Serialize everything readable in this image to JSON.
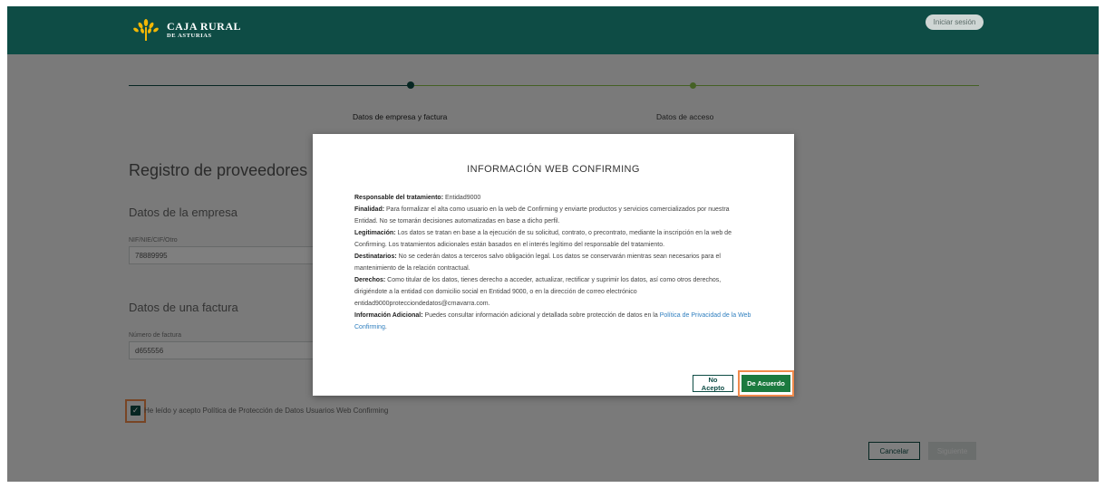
{
  "header": {
    "brand_main": "CAJA RURAL",
    "brand_sub": "DE ASTURIAS",
    "login_label": "Iniciar sesión",
    "color": "#0e4c45"
  },
  "stepper": {
    "steps": [
      {
        "label": "Datos de empresa y factura",
        "state": "active"
      },
      {
        "label": "Datos de acceso",
        "state": "pending"
      }
    ],
    "active_color": "#0e4c45",
    "pending_color": "#8bc34a"
  },
  "form": {
    "title": "Registro de proveedores",
    "company_section": "Datos de la empresa",
    "nif_label": "NIF/NIE/CIF/Otro",
    "nif_value": "78889995",
    "invoice_section": "Datos de una factura",
    "invoice_label": "Número de factura",
    "invoice_value": "d655556",
    "consent_label": "He leído y acepto Política de Protección de Datos Usuarios Web Confirming",
    "consent_checked": true,
    "cancel_label": "Cancelar",
    "next_label": "Siguiente"
  },
  "modal": {
    "title": "INFORMACIÓN WEB CONFIRMING",
    "items": [
      {
        "label": "Responsable del tratamiento:",
        "text": " Entidad9000"
      },
      {
        "label": "Finalidad:",
        "text": " Para formalizar el alta como usuario en la web de Confirming y enviarte productos y servicios comercializados por nuestra Entidad. No se tomarán decisiones automatizadas en base a dicho perfil."
      },
      {
        "label": "Legitimación:",
        "text": " Los datos se tratan en base a la ejecución de su solicitud, contrato, o precontrato, mediante la inscripción en la web de Confirming. Los tratamientos adicionales están basados en el interés legítimo del responsable del tratamiento."
      },
      {
        "label": "Destinatarios:",
        "text": " No se cederán datos a terceros salvo obligación legal. Los datos se conservarán mientras sean necesarios para el mantenimiento de la relación contractual."
      },
      {
        "label": "Derechos:",
        "text": " Como titular de los datos, tienes derecho a acceder, actualizar, rectificar y suprimir los datos, así como otros derechos, dirigiéndote a la entidad con domicilio social en Entidad 9000, o en la dirección de correo electrónico entidad9000protecciondedatos@crnavarra.com."
      }
    ],
    "extra_label": "Información Adicional:",
    "extra_text": " Puedes consultar información adicional y detallada sobre protección de datos en la ",
    "extra_link": "Política de Privacidad de la Web Confirming",
    "extra_end": ".",
    "decline_label": "No Acepto",
    "accept_label": "De Acuerdo",
    "accept_color": "#1b7a3f"
  },
  "highlight_color": "#f08a4b"
}
